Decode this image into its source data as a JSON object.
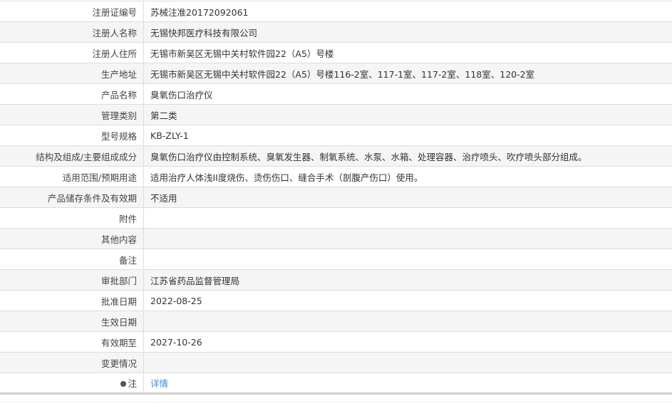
{
  "rows": [
    {
      "label": "注册证编号",
      "value": "苏械注准20172092061"
    },
    {
      "label": "注册人名称",
      "value": "无锡快邦医疗科技有限公司"
    },
    {
      "label": "注册人住所",
      "value": "无锡市新吴区无锡中关村软件园22（A5）号楼"
    },
    {
      "label": "生产地址",
      "value": "无锡市新吴区无锡中关村软件园22（A5）号楼116-2室、117-1室、117-2室、118室、120-2室"
    },
    {
      "label": "产品名称",
      "value": "臭氧伤口治疗仪"
    },
    {
      "label": "管理类别",
      "value": "第二类"
    },
    {
      "label": "型号规格",
      "value": "KB-ZLY-1"
    },
    {
      "label": "结构及组成/主要组成成分",
      "value": "臭氧伤口治疗仪由控制系统、臭氧发生器、制氧系统、水泵、水箱、处理容器、治疗喷头、吹疗喷头部分组成。"
    },
    {
      "label": "适用范围/预期用途",
      "value": "适用治疗人体浅II度烧伤、烫伤伤口、缝合手术（剖腹产伤口）使用。"
    },
    {
      "label": "产品储存条件及有效期",
      "value": "不适用"
    },
    {
      "label": "附件",
      "value": ""
    },
    {
      "label": "其他内容",
      "value": ""
    },
    {
      "label": "备注",
      "value": ""
    },
    {
      "label": "审批部门",
      "value": "江苏省药品监督管理局"
    },
    {
      "label": "批准日期",
      "value": "2022-08-25"
    },
    {
      "label": "生效日期",
      "value": ""
    },
    {
      "label": "有效期至",
      "value": "2027-10-26"
    },
    {
      "label": "变更情况",
      "value": ""
    }
  ],
  "note": {
    "label": "注",
    "link": "详情",
    "icon": "pin-icon"
  }
}
